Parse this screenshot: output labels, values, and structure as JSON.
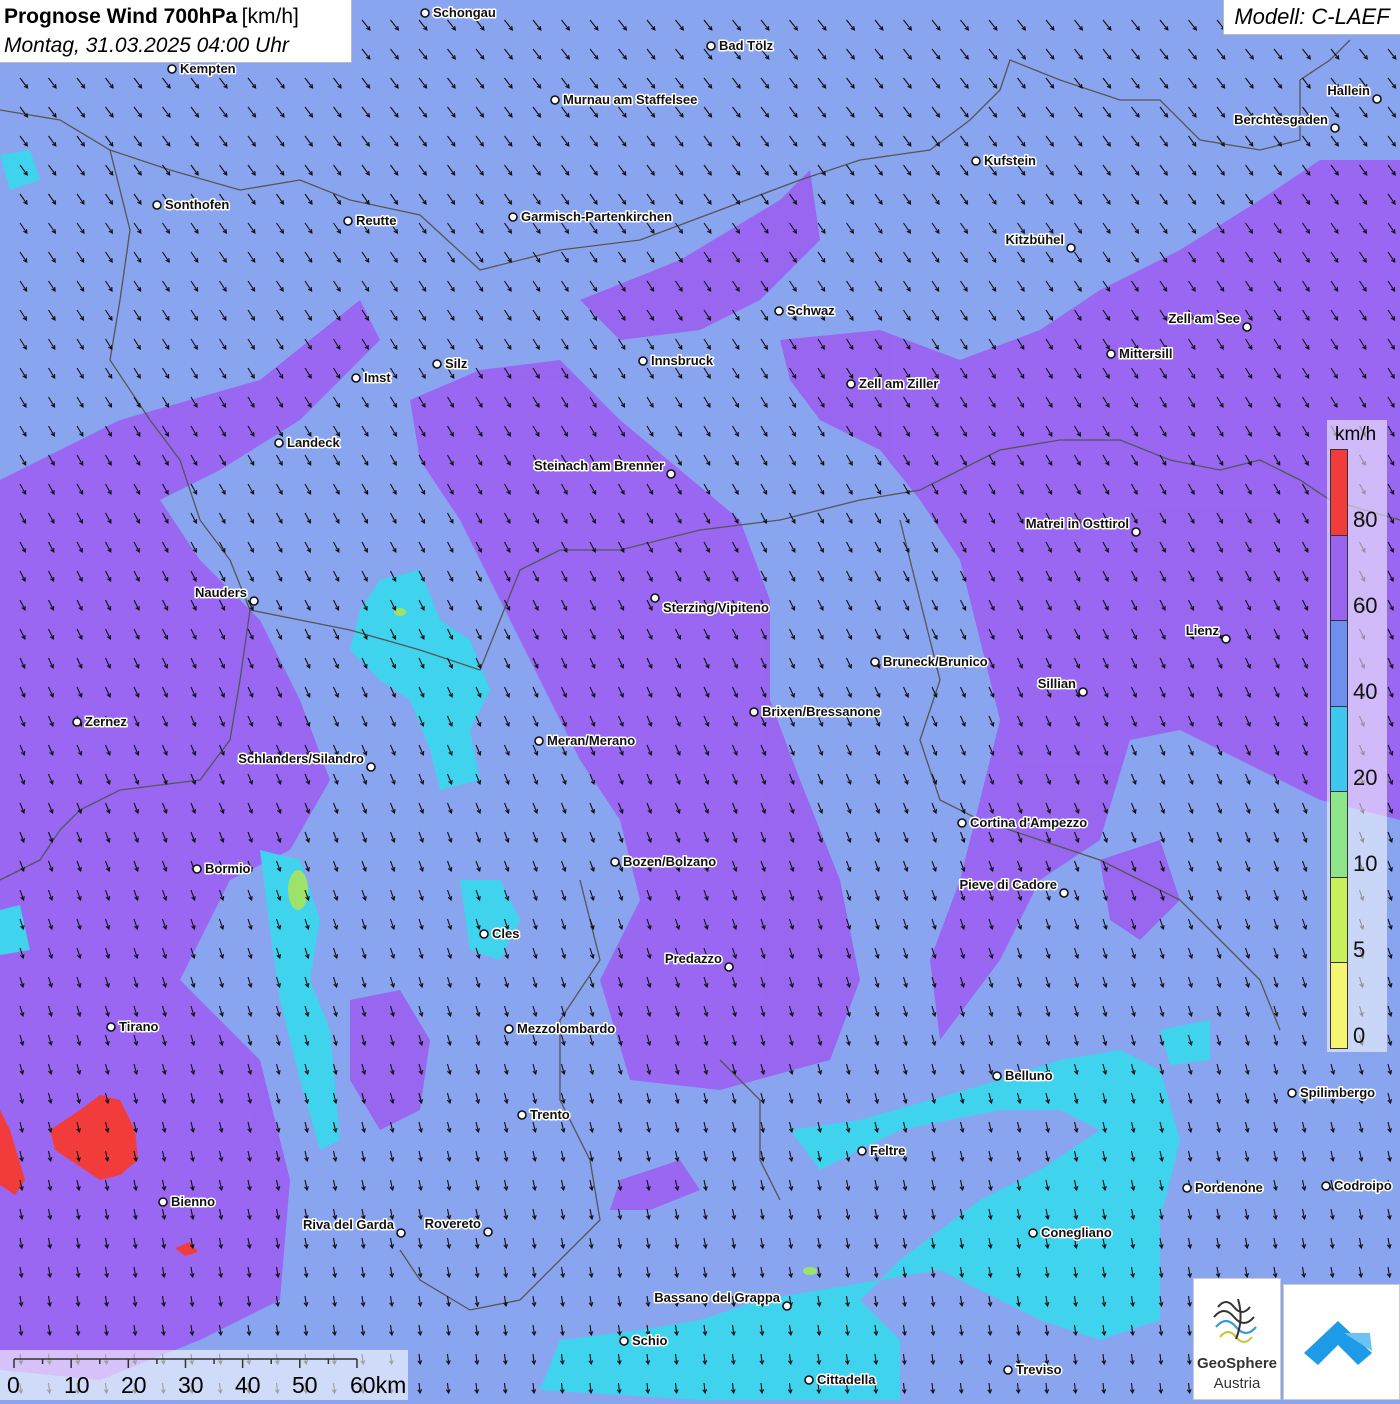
{
  "title": {
    "main": "Prognose Wind 700hPa",
    "unit": "[km/h]",
    "datetime": "Montag, 31.03.2025 04:00 Uhr"
  },
  "model": "Modell: C-LAEF",
  "colors": {
    "background_wind_30_40": "#8aa5f0",
    "wind_40_60": "#9a63f0",
    "wind_20_30": "#3fd3ee",
    "wind_80_plus": "#f23b3b",
    "wind_10_20": "#9de36a",
    "border": "#555555"
  },
  "legend": {
    "unit": "km/h",
    "ticks": [
      "80",
      "60",
      "40",
      "20",
      "10",
      "5",
      "0"
    ],
    "colors": [
      "#f23b3b",
      "#9a63f0",
      "#6d8ff0",
      "#3fc8ef",
      "#8fe58a",
      "#c7f05a",
      "#f5f571"
    ]
  },
  "cities": [
    {
      "name": "Schongau"
    },
    {
      "name": "Bad Tölz"
    },
    {
      "name": "Kempten"
    },
    {
      "name": "Murnau am Staffelsee"
    },
    {
      "name": "Hallein"
    },
    {
      "name": "Berchtesgaden"
    },
    {
      "name": "Kufstein"
    },
    {
      "name": "Sonthofen"
    },
    {
      "name": "Reutte"
    },
    {
      "name": "Garmisch-Partenkirchen"
    },
    {
      "name": "Kitzbühel"
    },
    {
      "name": "Schwaz"
    },
    {
      "name": "Zell am See"
    },
    {
      "name": "Innsbruck"
    },
    {
      "name": "Mittersill"
    },
    {
      "name": "Silz"
    },
    {
      "name": "Imst"
    },
    {
      "name": "Zell am Ziller"
    },
    {
      "name": "Landeck"
    },
    {
      "name": "Steinach am Brenner"
    },
    {
      "name": "Matrei in Osttirol"
    },
    {
      "name": "Nauders"
    },
    {
      "name": "Sterzing/Vipiteno"
    },
    {
      "name": "Lienz"
    },
    {
      "name": "Bruneck/Brunico"
    },
    {
      "name": "Sillian"
    },
    {
      "name": "Zernez"
    },
    {
      "name": "Brixen/Bressanone"
    },
    {
      "name": "Meran/Merano"
    },
    {
      "name": "Schlanders/Silandro"
    },
    {
      "name": "Cortina d'Ampezzo"
    },
    {
      "name": "Bozen/Bolzano"
    },
    {
      "name": "Bormio"
    },
    {
      "name": "Pieve di Cadore"
    },
    {
      "name": "Cles"
    },
    {
      "name": "Predazzo"
    },
    {
      "name": "Tirano"
    },
    {
      "name": "Mezzolombardo"
    },
    {
      "name": "Belluno"
    },
    {
      "name": "Spilimbergo"
    },
    {
      "name": "Trento"
    },
    {
      "name": "Feltre"
    },
    {
      "name": "Pordenone"
    },
    {
      "name": "Codroipo"
    },
    {
      "name": "Bienno"
    },
    {
      "name": "Riva del Garda"
    },
    {
      "name": "Rovereto"
    },
    {
      "name": "Conegliano"
    },
    {
      "name": "Bassano del Grappa"
    },
    {
      "name": "Schio"
    },
    {
      "name": "Treviso"
    },
    {
      "name": "Cittadella"
    }
  ],
  "scalebar": {
    "labels": [
      "0",
      "10",
      "20",
      "30",
      "40",
      "50",
      "60km"
    ]
  },
  "logos": {
    "geosphere_name": "GeoSphere",
    "geosphere_sub": "Austria",
    "geosphere_icon": "geosphere-logo",
    "second_icon": "blue-chevron-logo"
  },
  "wind_direction": "from north-northwest"
}
